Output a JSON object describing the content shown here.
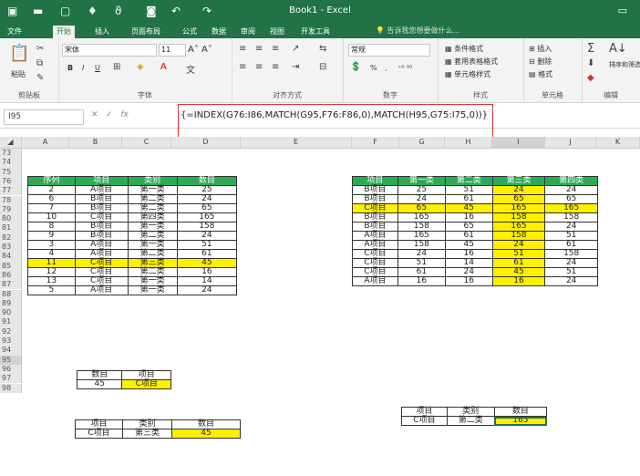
{
  "app": {
    "title": "Book1 - Excel",
    "qa_icons": [
      "save-icon",
      "open-icon",
      "new-icon",
      "print-icon",
      "undo-icon",
      "redo-icon"
    ]
  },
  "ribbon_tabs": [
    "文件",
    "开始",
    "插入",
    "页面布局",
    "公式",
    "数据",
    "审阅",
    "视图",
    "开发工具"
  ],
  "tell_me": "告诉我您想要做什么...",
  "ribbon": {
    "clipboard": {
      "paste": "粘贴",
      "label": "剪贴板"
    },
    "font": {
      "name": "宋体",
      "size": "11",
      "label": "字体",
      "buttons": [
        "B",
        "I",
        "U"
      ]
    },
    "alignment": {
      "label": "对齐方式"
    },
    "number": {
      "format": "常规",
      "label": "数字"
    },
    "styles": {
      "cond": "条件格式",
      "table": "套用表格格式",
      "cell": "单元格样式",
      "label": "样式"
    },
    "cells": {
      "insert": "插入",
      "delete": "删除",
      "format": "格式",
      "label": "单元格"
    },
    "editing": {
      "sort": "排序和筛选",
      "label": "编辑"
    }
  },
  "formula_bar": {
    "name_box": "I95",
    "formula": "{=INDEX(G76:I86,MATCH(G95,F76:F86,0),MATCH(H95,G75:I75,0))}"
  },
  "columns": [
    "A",
    "B",
    "C",
    "D",
    "E",
    "F",
    "G",
    "H",
    "I",
    "J",
    "K"
  ],
  "rows": [
    "73",
    "74",
    "75",
    "76",
    "77",
    "78",
    "79",
    "80",
    "81",
    "82",
    "83",
    "84",
    "85",
    "86",
    "87",
    "88",
    "89",
    "90",
    "91",
    "92",
    "93",
    "94",
    "95",
    "96",
    "97",
    "98"
  ],
  "left_table": {
    "headers": [
      "序列",
      "项目",
      "类别",
      "数目"
    ],
    "rows": [
      [
        "2",
        "A项目",
        "第一类",
        "25"
      ],
      [
        "6",
        "B项目",
        "第二类",
        "24"
      ],
      [
        "7",
        "B项目",
        "第二类",
        "65"
      ],
      [
        "10",
        "C项目",
        "第四类",
        "165"
      ],
      [
        "8",
        "B项目",
        "第一类",
        "158"
      ],
      [
        "9",
        "B项目",
        "第二类",
        "24"
      ],
      [
        "3",
        "A项目",
        "第一类",
        "51"
      ],
      [
        "4",
        "A项目",
        "第二类",
        "61"
      ],
      [
        "11",
        "C项目",
        "第三类",
        "45"
      ],
      [
        "12",
        "C项目",
        "第二类",
        "16"
      ],
      [
        "13",
        "C项目",
        "第一类",
        "14"
      ],
      [
        "5",
        "A项目",
        "第一类",
        "24"
      ]
    ]
  },
  "right_table": {
    "headers": [
      "项目",
      "第一类",
      "第二类",
      "第三类",
      "第四类"
    ],
    "rows": [
      [
        "B项目",
        "25",
        "51",
        "24",
        "24"
      ],
      [
        "B项目",
        "24",
        "61",
        "65",
        "65"
      ],
      [
        "C项目",
        "65",
        "45",
        "165",
        "165"
      ],
      [
        "B项目",
        "165",
        "16",
        "158",
        "158"
      ],
      [
        "B项目",
        "158",
        "65",
        "165",
        "24"
      ],
      [
        "A项目",
        "165",
        "61",
        "158",
        "51"
      ],
      [
        "A项目",
        "158",
        "45",
        "24",
        "61"
      ],
      [
        "C项目",
        "24",
        "16",
        "51",
        "158"
      ],
      [
        "C项目",
        "51",
        "14",
        "61",
        "24"
      ],
      [
        "C项目",
        "61",
        "24",
        "45",
        "51"
      ],
      [
        "A项目",
        "16",
        "16",
        "16",
        "24"
      ]
    ]
  },
  "small_table_1": {
    "headers": [
      "数目",
      "项目"
    ],
    "values": [
      "45",
      "C项目"
    ]
  },
  "small_table_2": {
    "headers": [
      "项目",
      "类别",
      "数目"
    ],
    "values": [
      "C项目",
      "第三类",
      "45"
    ]
  },
  "small_table_3": {
    "headers": [
      "项目",
      "类别",
      "数目"
    ],
    "values": [
      "C项目",
      "第二类",
      "165"
    ]
  },
  "colors": {
    "excel_green": "#217346",
    "header_green": "#2bab55",
    "highlight": "#ffef00",
    "callout_red": "#e03030"
  }
}
